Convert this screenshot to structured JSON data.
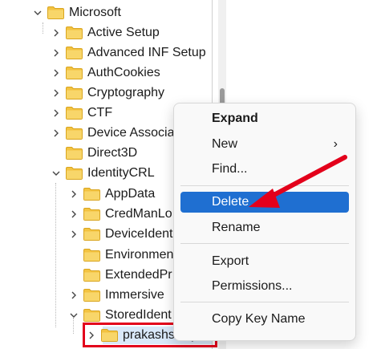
{
  "tree": {
    "items": [
      {
        "label": "Microsoft",
        "chevron": "down"
      },
      {
        "label": "Active Setup",
        "chevron": "right"
      },
      {
        "label": "Advanced INF Setup",
        "chevron": "right"
      },
      {
        "label": "AuthCookies",
        "chevron": "right"
      },
      {
        "label": "Cryptography",
        "chevron": "right"
      },
      {
        "label": "CTF",
        "chevron": "right"
      },
      {
        "label": "Device Associa",
        "chevron": "right"
      },
      {
        "label": "Direct3D",
        "chevron": "none"
      },
      {
        "label": "IdentityCRL",
        "chevron": "down"
      },
      {
        "label": "AppData",
        "chevron": "right"
      },
      {
        "label": "CredManLo",
        "chevron": "right"
      },
      {
        "label": "DeviceIdent",
        "chevron": "right"
      },
      {
        "label": "Environmen",
        "chevron": "none"
      },
      {
        "label": "ExtendedPr",
        "chevron": "none"
      },
      {
        "label": "Immersive",
        "chevron": "right"
      },
      {
        "label": "StoredIdent",
        "chevron": "down"
      },
      {
        "label": "prakashswayam",
        "chevron": "right"
      }
    ]
  },
  "context_menu": {
    "expand": "Expand",
    "new": "New",
    "new_submenu_glyph": "›",
    "find": "Find...",
    "delete": "Delete",
    "rename": "Rename",
    "export": "Export",
    "permissions": "Permissions...",
    "copy_key_name": "Copy Key Name"
  },
  "colors": {
    "highlight": "#1f6fd1",
    "annotation_red": "#e3001b",
    "folder": "#f3c341"
  }
}
